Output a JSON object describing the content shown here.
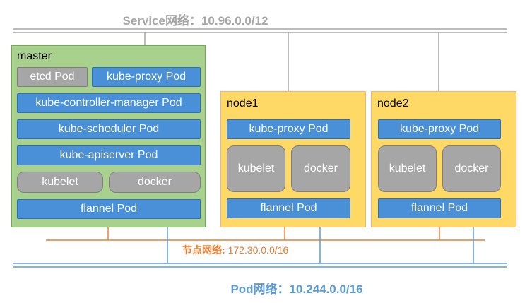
{
  "service_network": {
    "label": "Service网络：10.96.0.0/12"
  },
  "node_network": {
    "prefix": "节点网络:",
    "cidr": "172.30.0.0/16"
  },
  "pod_network": {
    "label": "Pod网络：10.244.0.0/16"
  },
  "master": {
    "title": "master",
    "etcd": "etcd Pod",
    "kube_proxy": "kube-proxy Pod",
    "controller_manager": "kube-controller-manager Pod",
    "scheduler": "kube-scheduler Pod",
    "apiserver": "kube-apiserver Pod",
    "kubelet": "kubelet",
    "docker": "docker",
    "flannel": "flannel Pod"
  },
  "nodes": [
    {
      "title": "node1",
      "kube_proxy": "kube-proxy Pod",
      "kubelet": "kubelet",
      "docker": "docker",
      "flannel": "flannel Pod"
    },
    {
      "title": "node2",
      "kube_proxy": "kube-proxy Pod",
      "kubelet": "kubelet",
      "docker": "docker",
      "flannel": "flannel Pod"
    }
  ],
  "colors": {
    "service_line": "#a6a6a6",
    "node_line": "#ed7d31",
    "pod_line": "#5b9bd5",
    "master_fill": "#a9d18e",
    "node_fill": "#ffd966",
    "pod_fill": "#4a90d9",
    "component_fill": "#a6a6a6"
  }
}
